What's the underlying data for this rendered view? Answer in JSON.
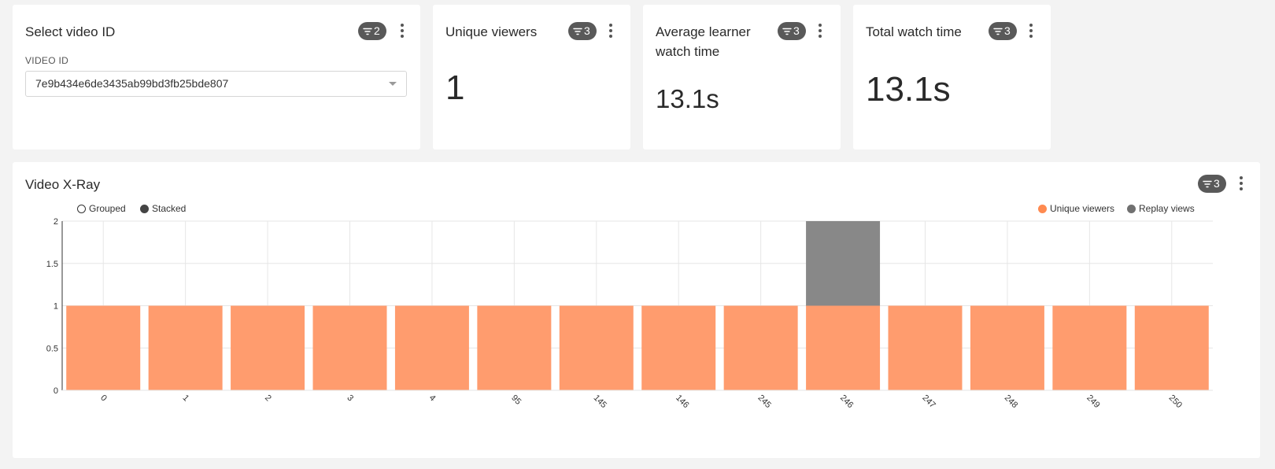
{
  "cards": {
    "select_video": {
      "title": "Select video ID",
      "filter_count": "2",
      "field_label": "VIDEO ID",
      "selected_value": "7e9b434e6de3435ab99bd3fb25bde807"
    },
    "unique_viewers": {
      "title": "Unique viewers",
      "filter_count": "3",
      "value": "1"
    },
    "avg_watch": {
      "title_line1": "Average learner",
      "title_line2": "watch time",
      "filter_count": "3",
      "value": "13.1s"
    },
    "total_watch": {
      "title": "Total watch time",
      "filter_count": "3",
      "value": "13.1s"
    }
  },
  "xray": {
    "title": "Video X-Ray",
    "filter_count": "3",
    "mode_options": [
      {
        "label": "Grouped",
        "selected": false
      },
      {
        "label": "Stacked",
        "selected": true
      }
    ]
  },
  "icons": {
    "filter": "filter-icon",
    "more": "more-vertical-icon",
    "caret": "chevron-down-icon"
  },
  "colors": {
    "unique": "#ff9c6e",
    "unique_legend": "#ff8a50",
    "replay": "#888888",
    "replay_legend": "#707070"
  },
  "chart_data": {
    "type": "bar",
    "stacked": true,
    "categories": [
      "0",
      "1",
      "2",
      "3",
      "4",
      "95",
      "145",
      "146",
      "245",
      "246",
      "247",
      "248",
      "249",
      "250"
    ],
    "series": [
      {
        "name": "Unique viewers",
        "values": [
          1,
          1,
          1,
          1,
          1,
          1,
          1,
          1,
          1,
          1,
          1,
          1,
          1,
          1
        ]
      },
      {
        "name": "Replay views",
        "values": [
          0,
          0,
          0,
          0,
          0,
          0,
          0,
          0,
          0,
          1,
          0,
          0,
          0,
          0
        ]
      }
    ],
    "yticks": [
      "0",
      "0.5",
      "1",
      "1.5",
      "2"
    ],
    "ylim": [
      0,
      2
    ],
    "grid": true,
    "legend_position": "top-right"
  }
}
